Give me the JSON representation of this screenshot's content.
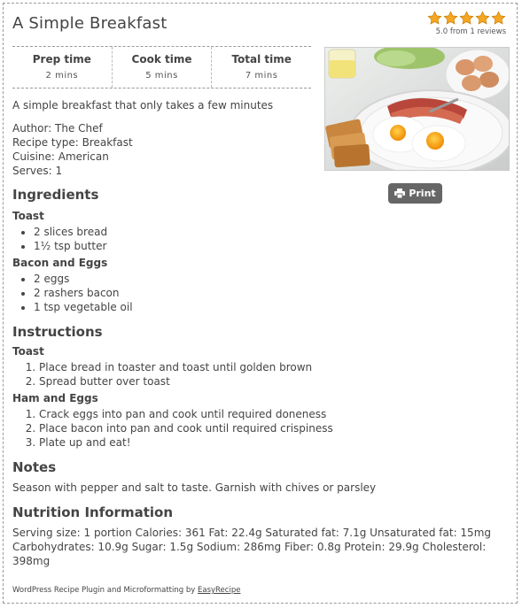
{
  "recipe": {
    "title": "A Simple Breakfast",
    "rating": {
      "stars": 5,
      "text": "5.0 from 1 reviews",
      "star_color": "#f5a623"
    },
    "times": [
      {
        "label": "Prep time",
        "value": "2 mins"
      },
      {
        "label": "Cook time",
        "value": "5 mins"
      },
      {
        "label": "Total time",
        "value": "7 mins"
      }
    ],
    "summary": "A simple breakfast that only takes a few minutes",
    "author": "Author: The Chef",
    "type": "Recipe type: Breakfast",
    "cuisine": "Cuisine: American",
    "serves": "Serves: 1",
    "print_label": "Print"
  },
  "ingredients": {
    "heading": "Ingredients",
    "groups": [
      {
        "name": "Toast",
        "items": [
          "2 slices bread",
          "1½ tsp butter"
        ]
      },
      {
        "name": "Bacon and Eggs",
        "items": [
          "2 eggs",
          "2 rashers bacon",
          "1 tsp vegetable oil"
        ]
      }
    ]
  },
  "instructions": {
    "heading": "Instructions",
    "groups": [
      {
        "name": "Toast",
        "steps": [
          "Place bread in toaster and toast until golden brown",
          "Spread butter over toast"
        ]
      },
      {
        "name": "Ham and Eggs",
        "steps": [
          "Crack eggs into pan and cook until required doneness",
          "Place bacon into pan and cook until required crispiness",
          "Plate up and eat!"
        ]
      }
    ]
  },
  "notes": {
    "heading": "Notes",
    "text": "Season with pepper and salt to taste. Garnish with chives or parsley"
  },
  "nutrition": {
    "heading": "Nutrition Information",
    "text": "Serving size: 1 portion Calories: 361 Fat: 22.4g Saturated fat: 7.1g Unsaturated fat: 15mg Carbohydrates: 10.9g Sugar: 1.5g Sodium: 286mg Fiber: 0.8g Protein: 29.9g Cholesterol: 398mg"
  },
  "footer": {
    "prefix": "WordPress Recipe Plugin and Microformatting by ",
    "link": "EasyRecipe"
  }
}
